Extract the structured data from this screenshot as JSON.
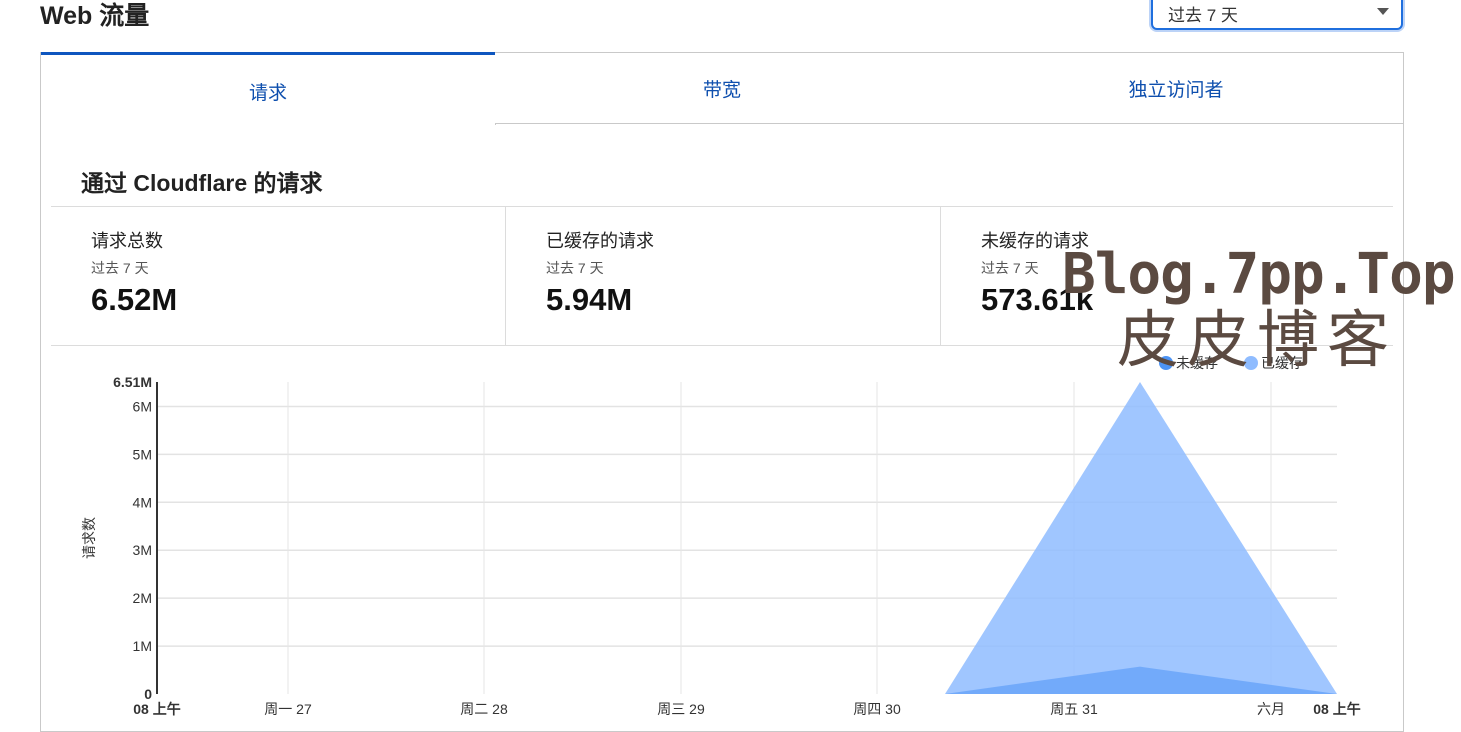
{
  "header": {
    "title": "Web 流量"
  },
  "time_range": {
    "selected": "过去 7 天"
  },
  "tabs": [
    {
      "label": "请求",
      "active": true
    },
    {
      "label": "带宽",
      "active": false
    },
    {
      "label": "独立访问者",
      "active": false
    }
  ],
  "section": {
    "title": "通过 Cloudflare 的请求"
  },
  "stats": [
    {
      "label": "请求总数",
      "period": "过去 7 天",
      "value": "6.52M"
    },
    {
      "label": "已缓存的请求",
      "period": "过去 7 天",
      "value": "5.94M"
    },
    {
      "label": "未缓存的请求",
      "period": "过去 7 天",
      "value": "573.61k"
    }
  ],
  "chart_data": {
    "type": "area",
    "ylabel": "请求数",
    "ylim": [
      0,
      6510000
    ],
    "y_ticks": [
      {
        "value": 0,
        "label": "0",
        "bold": true
      },
      {
        "value": 1000000,
        "label": "1M"
      },
      {
        "value": 2000000,
        "label": "2M"
      },
      {
        "value": 3000000,
        "label": "3M"
      },
      {
        "value": 4000000,
        "label": "4M"
      },
      {
        "value": 5000000,
        "label": "5M"
      },
      {
        "value": 6000000,
        "label": "6M"
      },
      {
        "value": 6510000,
        "label": "6.51M",
        "bold": true
      }
    ],
    "x_ticks": [
      {
        "label": "08 上午",
        "bold": true
      },
      {
        "label": "周一 27"
      },
      {
        "label": "周二 28"
      },
      {
        "label": "周三 29"
      },
      {
        "label": "周四 30"
      },
      {
        "label": "周五 31"
      },
      {
        "label": "六月"
      },
      {
        "label": "08 上午",
        "bold": true
      }
    ],
    "legend": {
      "position": "top-right"
    },
    "series": [
      {
        "name": "未缓存",
        "color": "#4d94f5",
        "points": [
          0,
          0,
          0,
          0,
          0,
          0,
          570000,
          0
        ]
      },
      {
        "name": "已缓存",
        "color": "#8fbcff",
        "points": [
          0,
          0,
          0,
          0,
          0,
          0,
          6510000,
          0
        ]
      }
    ]
  },
  "watermark": {
    "line1": "Blog.7pp.Top",
    "line2": "皮皮博客"
  }
}
